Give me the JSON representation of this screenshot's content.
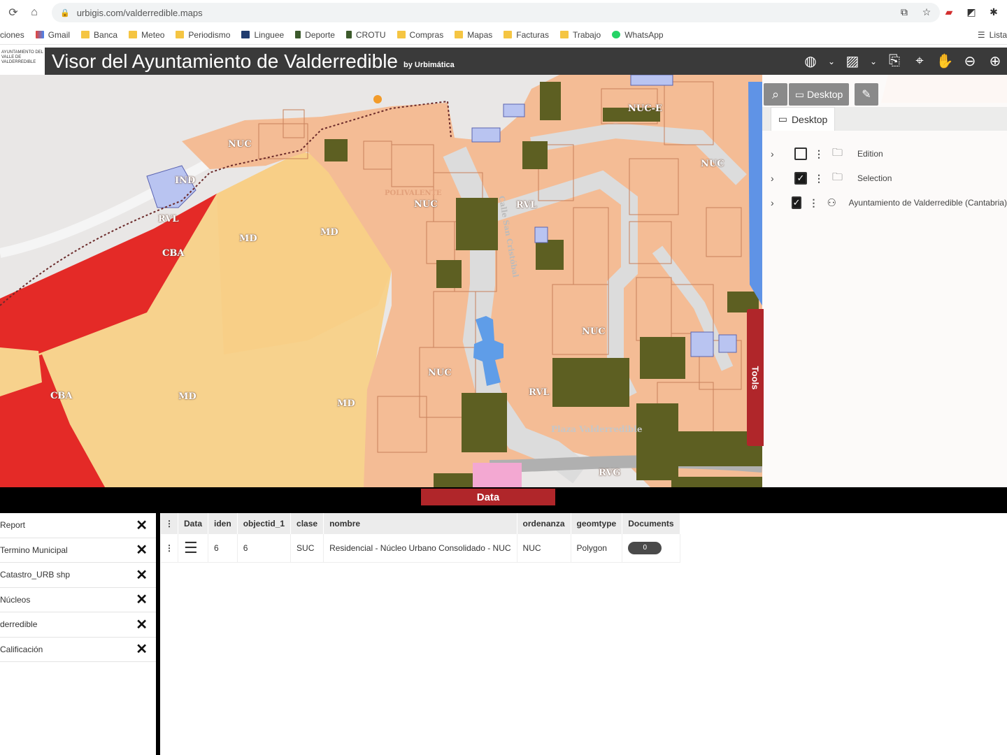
{
  "browser": {
    "url": "urbigis.com/valderredible.maps",
    "bookmarks": [
      "ciones",
      "Gmail",
      "Banca",
      "Meteo",
      "Periodismo",
      "Linguee",
      "Deporte",
      "CROTU",
      "Compras",
      "Mapas",
      "Facturas",
      "Trabajo",
      "WhatsApp"
    ],
    "reading_list": "Lista"
  },
  "header": {
    "logo_text": "AYUNTAMIENTO DEL VALLE DE VALDERREDIBLE",
    "title": "Visor del Ayuntamiento de Valderredible",
    "by": "by Urbimática",
    "icons": [
      "globe-icon",
      "image-icon",
      "search-doc-icon",
      "pin-icon",
      "hand-icon",
      "zoom-out-icon",
      "zoom-in-icon"
    ]
  },
  "map": {
    "labels": [
      "NUC",
      "IND",
      "RVL",
      "CBA",
      "MD",
      "MD",
      "NUC",
      "RVL",
      "NUC-E",
      "NUC",
      "NUC",
      "NUC",
      "MD",
      "CBA",
      "MD",
      "RVL",
      "RVG",
      "POLIVALENTE",
      "Calle San Cristóbal",
      "Plaza Valderredible"
    ]
  },
  "layer_panel": {
    "desktop_button": "Desktop",
    "tab": "Desktop",
    "layers": [
      {
        "label": "Edition",
        "checked": false
      },
      {
        "label": "Selection",
        "checked": true
      },
      {
        "label": "Ayuntamiento de Valderredible (Cantabria)",
        "checked": true
      }
    ]
  },
  "tools_tab": "Tools",
  "data_tab": "Data",
  "left_list": [
    "Report",
    "Termino Municipal",
    "Catastro_URB shp",
    "Núcleos",
    "derredible",
    "Calificación"
  ],
  "table": {
    "columns": [
      "Data",
      "iden",
      "objectid_1",
      "clase",
      "nombre",
      "ordenanza",
      "geomtype",
      "Documents"
    ],
    "rows": [
      {
        "iden": "6",
        "objectid_1": "6",
        "clase": "SUC",
        "nombre": "Residencial - Núcleo Urbano Consolidado - NUC",
        "ordenanza": "NUC",
        "geomtype": "Polygon",
        "documents": "0"
      }
    ]
  }
}
